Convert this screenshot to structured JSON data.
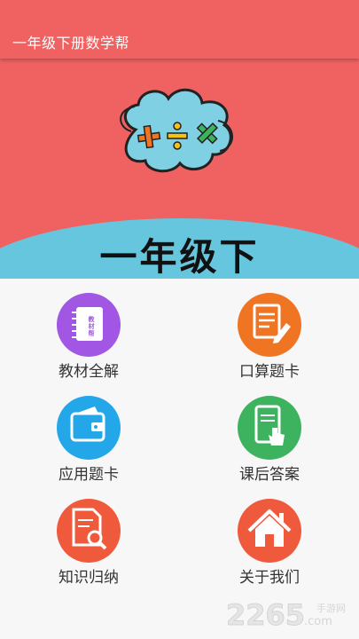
{
  "app": {
    "title": "一年级下册数学帮"
  },
  "banner": {
    "heading": "一年级下",
    "symbols": "+ ÷ ×"
  },
  "menu": {
    "items": [
      {
        "label": "教材全解",
        "icon": "notebook-icon",
        "color": "#a156e4",
        "icon_text": "教材帮"
      },
      {
        "label": "口算题卡",
        "icon": "document-edit-icon",
        "color": "#f07523"
      },
      {
        "label": "应用题卡",
        "icon": "wallet-icon",
        "color": "#23a7e8"
      },
      {
        "label": "课后答案",
        "icon": "tablet-touch-icon",
        "color": "#3db35f"
      },
      {
        "label": "知识归纳",
        "icon": "document-search-icon",
        "color": "#ef5a3c"
      },
      {
        "label": "关于我们",
        "icon": "home-icon",
        "color": "#ef5a3c"
      }
    ]
  },
  "watermark": {
    "brand": "2265",
    "domain": ".com",
    "site_name": "手游网"
  },
  "colors": {
    "appbar": "#ef6261",
    "banner_hill": "#66c6dd",
    "background": "#f7f7f7"
  }
}
